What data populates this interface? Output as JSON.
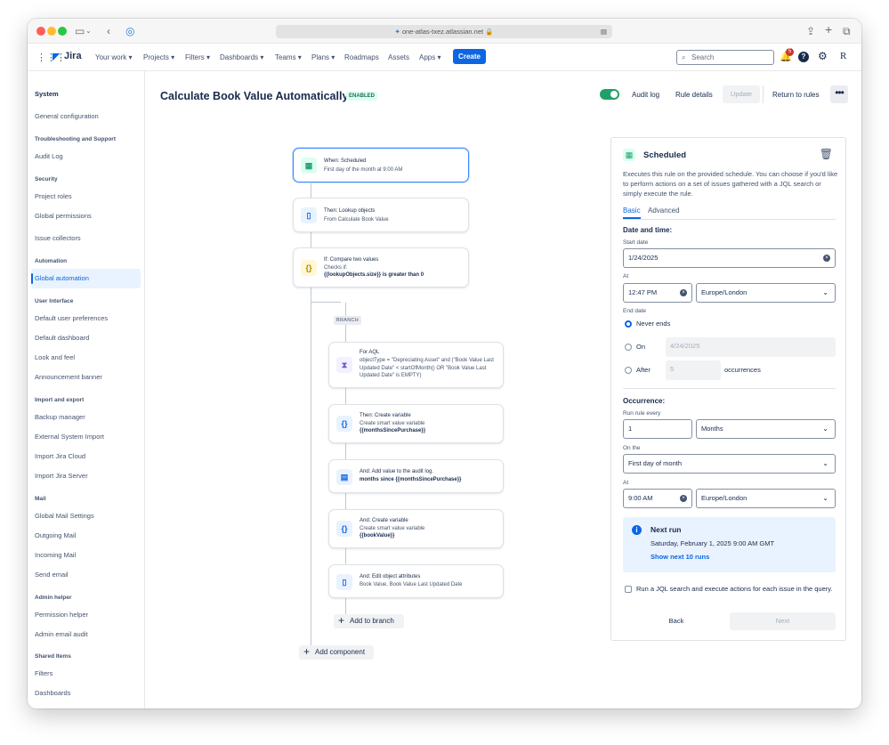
{
  "browser": {
    "url": "one-atlas-txez.atlassian.net"
  },
  "topnav": {
    "product": "Jira",
    "items": [
      "Your work",
      "Projects",
      "Filters",
      "Dashboards",
      "Teams",
      "Plans",
      "Roadmaps",
      "Assets",
      "Apps"
    ],
    "create_label": "Create",
    "search_placeholder": "Search",
    "notification_count": "5",
    "avatar": "R"
  },
  "sidebar": {
    "sections": [
      {
        "heading": "System",
        "items": [
          "General configuration"
        ]
      },
      {
        "heading": "Troubleshooting and Support",
        "items": [
          "Audit Log"
        ]
      },
      {
        "heading": "Security",
        "items": [
          "Project roles",
          "Global permissions",
          "Issue collectors"
        ]
      },
      {
        "heading": "Automation",
        "items": [
          "Global automation"
        ]
      },
      {
        "heading": "User Interface",
        "items": [
          "Default user preferences",
          "Default dashboard",
          "Look and feel",
          "Announcement banner"
        ]
      },
      {
        "heading": "Import and export",
        "items": [
          "Backup manager",
          "External System Import",
          "Import Jira Cloud",
          "Import Jira Server"
        ]
      },
      {
        "heading": "Mail",
        "items": [
          "Global Mail Settings",
          "Outgoing Mail",
          "Incoming Mail",
          "Send email"
        ]
      },
      {
        "heading": "Admin helper",
        "items": [
          "Permission helper",
          "Admin email audit"
        ]
      },
      {
        "heading": "Shared Items",
        "items": [
          "Filters",
          "Dashboards"
        ]
      }
    ]
  },
  "header": {
    "title": "Calculate Book Value Automatically",
    "status": "ENABLED",
    "audit_log": "Audit log",
    "rule_details": "Rule details",
    "update": "Update",
    "return": "Return to rules"
  },
  "flow": {
    "trigger": {
      "title": "When: Scheduled",
      "sub": "First day of the month at 9:00 AM"
    },
    "lookup": {
      "title": "Then: Lookup objects",
      "sub": "From Calculate Book Value"
    },
    "condition": {
      "title": "If: Compare two values",
      "sub1": "Checks if:",
      "sub2": "{{lookupObjects.size}} is greater than 0"
    },
    "branch_label": "BRANCH",
    "for_aql": {
      "title": "For AQL",
      "sub": "objectType = \"Depreciating Asset\" and (\"Book Value Last Updated Date\" < startOfMonth() OR \"Book Value Last Updated Date\" is EMPTY)"
    },
    "create_var1": {
      "title": "Then: Create variable",
      "sub": "Create smart value variable",
      "var": "{{monthsSincePurchase}}"
    },
    "audit": {
      "title": "And: Add value to the audit log.",
      "sub": "months since {{monthsSincePurchase}}"
    },
    "create_var2": {
      "title": "And: Create variable",
      "sub": "Create smart value variable",
      "var": "{{bookValue}}"
    },
    "edit": {
      "title": "And: Edit object attributes",
      "sub": "Book Value, Book Value Last Updated Date"
    },
    "add_to_branch": "Add to branch",
    "add_component": "Add component"
  },
  "panel": {
    "title": "Scheduled",
    "description": "Executes this rule on the provided schedule. You can choose if you'd like to perform actions on a set of issues gathered with a JQL search or simply execute the rule.",
    "tab_basic": "Basic",
    "tab_advanced": "Advanced",
    "date_time": "Date and time:",
    "start_date_label": "Start date",
    "start_date": "1/24/2025",
    "at_label": "At",
    "start_time": "12:47 PM",
    "timezone": "Europe/London",
    "end_date_label": "End date",
    "never_ends": "Never ends",
    "on": "On",
    "on_date": "4/24/2025",
    "after": "After",
    "after_value": "5",
    "occurrences": "occurrences",
    "occurrence": "Occurrence:",
    "run_every_label": "Run rule every",
    "run_every": "1",
    "unit": "Months",
    "on_the_label": "On the",
    "on_the": "First day of month",
    "at_label2": "At",
    "time2": "9:00 AM",
    "timezone2": "Europe/London",
    "next_run_title": "Next run",
    "next_run_value": "Saturday, February 1, 2025 9:00 AM GMT",
    "show_next": "Show next 10 runs",
    "jql_check": "Run a JQL search and execute actions for each issue in the query.",
    "back": "Back",
    "next": "Next"
  },
  "colors": {
    "primary": "#0c66e4",
    "enabled_bg": "#dcfff1",
    "enabled_text": "#216e4e",
    "toggle": "#22a06b"
  }
}
